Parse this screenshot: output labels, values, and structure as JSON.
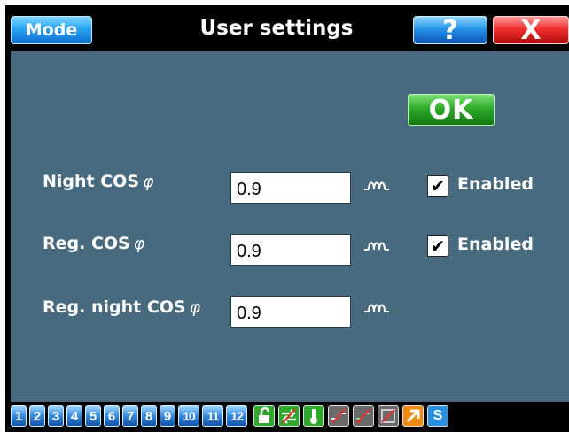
{
  "titlebar": {
    "mode_label": "Mode",
    "title": "User settings",
    "help_label": "?",
    "close_label": "X"
  },
  "ok_label": "OK",
  "rows": [
    {
      "label": "Night COS",
      "value": "0.9",
      "enabled_label": "Enabled",
      "enabled": true
    },
    {
      "label": "Reg. COS",
      "value": "0.9",
      "enabled_label": "Enabled",
      "enabled": true
    },
    {
      "label": "Reg. night COS",
      "value": "0.9"
    }
  ],
  "phi_symbol": "φ",
  "check_mark": "✔",
  "bottombar": {
    "numbers": [
      "1",
      "2",
      "3",
      "4",
      "5",
      "6",
      "7",
      "8",
      "9",
      "10",
      "11",
      "12"
    ],
    "tools": [
      {
        "icon": "unlock-icon",
        "color": "#2fa82b"
      },
      {
        "icon": "arrows-swap-icon",
        "color": "#2fa82b"
      },
      {
        "icon": "thermometer-icon",
        "color": "#2fa82b"
      },
      {
        "icon": "disconnect-icon",
        "color": "#6a6a6a"
      },
      {
        "icon": "disconnect-icon",
        "color": "#6a6a6a"
      },
      {
        "icon": "disabled-icon",
        "color": "#6a6a6a"
      },
      {
        "icon": "arrow-up-right-icon",
        "color": "#f08a10"
      },
      {
        "icon": "s-icon",
        "color": "#2b8fe0"
      }
    ],
    "s_label": "S"
  },
  "colors": {
    "panel": "#476a7f",
    "titlebar": "#000000"
  }
}
